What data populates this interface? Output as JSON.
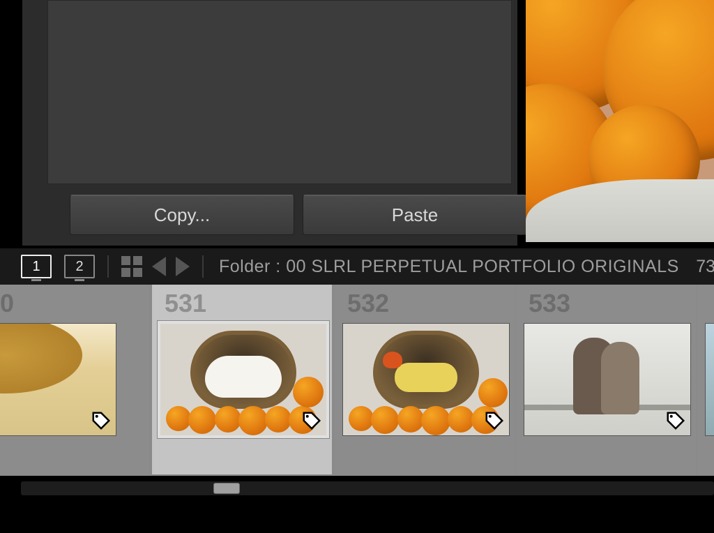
{
  "panel": {
    "copy_label": "Copy...",
    "paste_label": "Paste"
  },
  "toolbar": {
    "screen_buttons": [
      "1",
      "2"
    ],
    "folder_prefix": "Folder : ",
    "folder_name": "00 SLRL PERPETUAL PORTFOLIO ORIGINALS",
    "count_fragment": "73"
  },
  "filmstrip": {
    "items": [
      {
        "index": "0",
        "partial_index": "0",
        "selected": false
      },
      {
        "index": "531",
        "selected": true
      },
      {
        "index": "532",
        "selected": false
      },
      {
        "index": "533",
        "selected": false
      },
      {
        "index": "",
        "selected": false
      }
    ]
  }
}
